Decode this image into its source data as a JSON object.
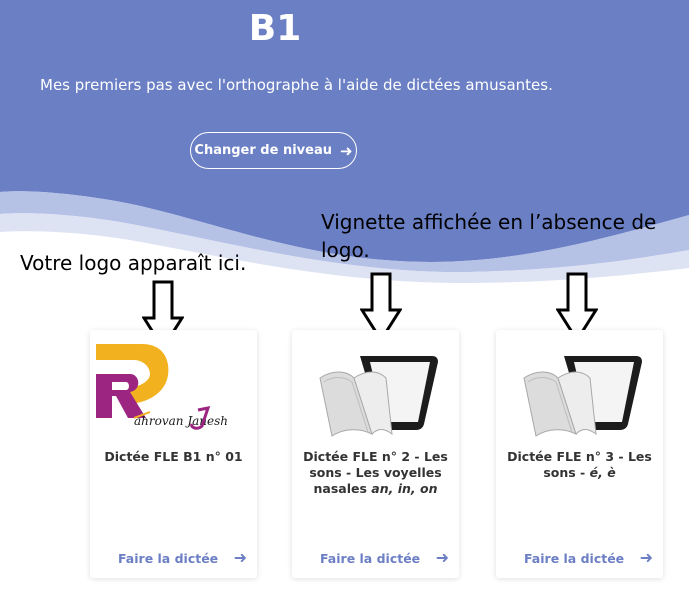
{
  "hero": {
    "level": "B1",
    "subtitle": "Mes premiers pas avec l'orthographe à l'aide de dictées amusantes.",
    "change_level_label": "Changer de niveau",
    "bg_color": "#6b7fc4"
  },
  "annotations": {
    "left": "Votre logo apparaît ici.",
    "right": "Vignette affichée en l’absence de logo."
  },
  "cards": [
    {
      "title": "Dictée FLE B1 n° 01",
      "link": "Faire la dictée",
      "thumbnail": "custom-logo",
      "logo_text": "ahrovan Janesh"
    },
    {
      "title_plain": "Dictée FLE n° 2 - Les sons - Les voyelles nasales",
      "title_italic": "an, in, on",
      "link": "Faire la dictée",
      "thumbnail": "tablet-book-icon"
    },
    {
      "title_plain": "Dictée FLE n° 3 - Les sons -",
      "title_italic": "é, è",
      "link": "Faire la dictée",
      "thumbnail": "tablet-book-icon"
    }
  ],
  "colors": {
    "accent": "#6c7fc4",
    "title": "#333333"
  }
}
